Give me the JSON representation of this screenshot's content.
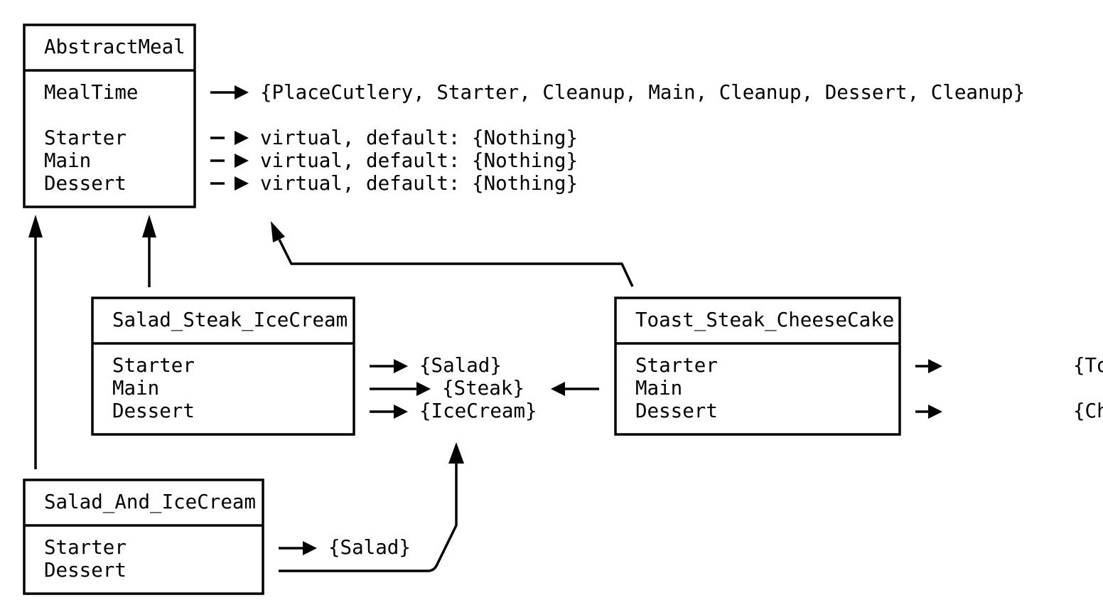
{
  "classes": {
    "abstract_meal": {
      "name": "AbstractMeal",
      "members": [
        "MealTime",
        "Starter",
        "Main",
        "Dessert"
      ],
      "values": [
        "{PlaceCutlery, Starter, Cleanup, Main, Cleanup, Dessert, Cleanup}",
        "virtual, default: {Nothing}",
        "virtual, default: {Nothing}",
        "virtual, default: {Nothing}"
      ]
    },
    "salad_steak_icecream": {
      "name": "Salad_Steak_IceCream",
      "members": [
        "Starter",
        "Main",
        "Dessert"
      ],
      "values": [
        "{Salad}",
        "{Steak}",
        "{IceCream}"
      ]
    },
    "toast_steak_cheesecake": {
      "name": "Toast_Steak_CheeseCake",
      "members": [
        "Starter",
        "Main",
        "Dessert"
      ],
      "values": [
        "{Toast}",
        "{CheeseCake"
      ]
    },
    "salad_and_icecream": {
      "name": "Salad_And_IceCream",
      "members": [
        "Starter",
        "Dessert"
      ],
      "values": [
        "{Salad}"
      ]
    }
  }
}
